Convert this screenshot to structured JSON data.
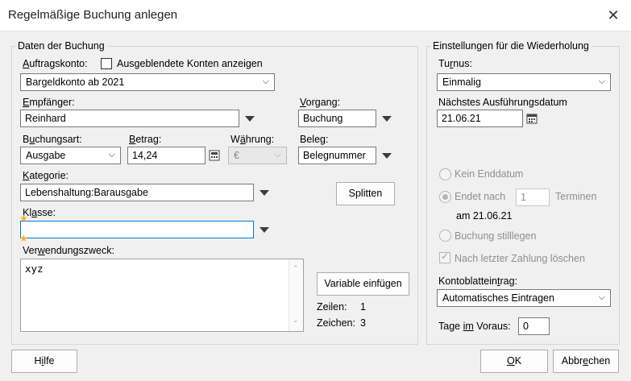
{
  "window": {
    "title": "Regelmäßige Buchung anlegen"
  },
  "left_group": {
    "title": "Daten der Buchung",
    "auftragskonto": {
      "label_u": "A",
      "label_rest": "uftragskonto:",
      "value": "Bargeldkonto ab 2021"
    },
    "hidden_accounts": {
      "label": "Ausgeblendete Konten anzeigen",
      "checked": false
    },
    "empfaenger": {
      "label_u": "E",
      "label_rest": "mpfänger:",
      "value": "Reinhard"
    },
    "vorgang": {
      "label_u": "V",
      "label_rest": "organg:",
      "value": "Buchung"
    },
    "buchungsart": {
      "label_pre": "B",
      "label_u": "u",
      "label_rest": "chungsart:",
      "value": "Ausgabe"
    },
    "betrag": {
      "label_u": "B",
      "label_rest": "etrag:",
      "value": "14,24"
    },
    "waehrung": {
      "label_pre": "W",
      "label_u": "ä",
      "label_rest": "hrung:",
      "value": "€"
    },
    "beleg": {
      "label_pre": "Bele",
      "label_u": "g",
      "label_rest": ":",
      "value": "Belegnummer"
    },
    "kategorie": {
      "label_u": "K",
      "label_rest": "ategorie:",
      "value": "Lebenshaltung:Barausgabe"
    },
    "splitten_button": "Splitten",
    "klasse": {
      "label_pre": "Kl",
      "label_u": "a",
      "label_rest": "sse:",
      "value": ""
    },
    "verwendungszweck": {
      "label_pre": "Ver",
      "label_u": "w",
      "label_rest": "endungszweck:",
      "value": "xyz"
    },
    "variable_button": "Variable einfügen",
    "zeilen": {
      "label": "Zeilen:",
      "value": "1"
    },
    "zeichen": {
      "label": "Zeichen:",
      "value": "3"
    }
  },
  "right_group": {
    "title": "Einstellungen für die Wiederholung",
    "turnus": {
      "label_pre": "Tu",
      "label_u": "r",
      "label_rest": "nus:",
      "value": "Einmalig"
    },
    "naechstes": {
      "label": "Nächstes Ausführungsdatum",
      "value": "21.06.21"
    },
    "kein_enddatum": "Kein Enddatum",
    "endet_nach": {
      "label": "Endet nach",
      "value": "1",
      "suffix": "Terminen",
      "date_text": "am 21.06.21"
    },
    "stilllegen": "Buchung stilllegen",
    "loeschen": "Nach letzter Zahlung löschen",
    "kontoblatt": {
      "label_pre": "Kontoblattein",
      "label_u": "t",
      "label_rest": "rag:",
      "value": "Automatisches Eintragen"
    },
    "tage": {
      "label_pre": "Tage ",
      "label_u": "im",
      "label_rest": " Voraus:",
      "value": "0"
    }
  },
  "footer": {
    "help_pre": "H",
    "help_u": "i",
    "help_rest": "lfe",
    "ok_u": "O",
    "ok_rest": "K",
    "cancel_pre": "Abbr",
    "cancel_u": "e",
    "cancel_rest": "chen"
  },
  "colors": {
    "focus_border": "#0078d7",
    "star": "#f2b21b"
  }
}
